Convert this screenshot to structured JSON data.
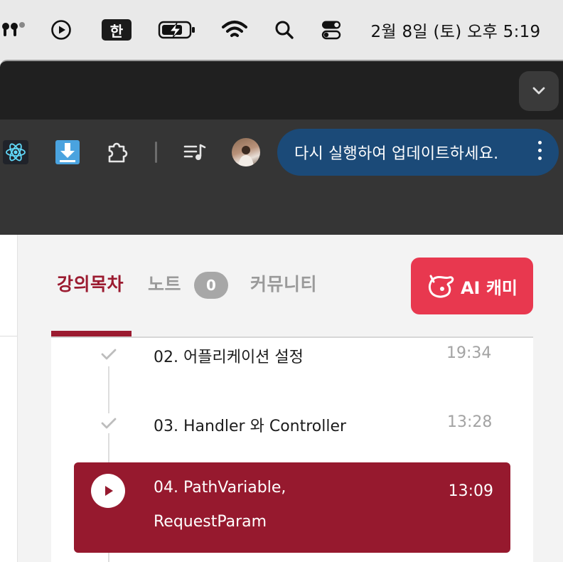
{
  "menubar": {
    "input_source": "한",
    "clock": "2월 8일 (토) 오후 5:19",
    "icons": [
      "airpods-icon",
      "play-circle-icon",
      "input-source-icon",
      "battery-charging-icon",
      "wifi-icon",
      "spotlight-search-icon",
      "control-center-icon"
    ]
  },
  "browser": {
    "extensions": [
      "react-devtools-icon",
      "download-icon",
      "puzzle-extension-icon",
      "media-queue-icon"
    ],
    "update_message": "다시 실행하여 업데이트하세요."
  },
  "course_panel": {
    "tabs": [
      {
        "label": "강의목차",
        "active": true
      },
      {
        "label": "노트",
        "count": "0"
      },
      {
        "label": "커뮤니티"
      }
    ],
    "ai_button_label": "AI 캐미",
    "lessons": [
      {
        "title": "02. 어플리케이션 설정",
        "duration": "19:34",
        "status": "completed"
      },
      {
        "title": "03. Handler 와 Controller",
        "duration": "13:28",
        "status": "completed"
      },
      {
        "title_line1": "04. PathVariable,",
        "title_line2": "RequestParam",
        "duration": "13:09",
        "status": "playing"
      }
    ]
  },
  "colors": {
    "accent": "#9b1b30",
    "ai_button": "#e8384f",
    "update_pill": "#1b4a78",
    "toolbar": "#353535"
  }
}
